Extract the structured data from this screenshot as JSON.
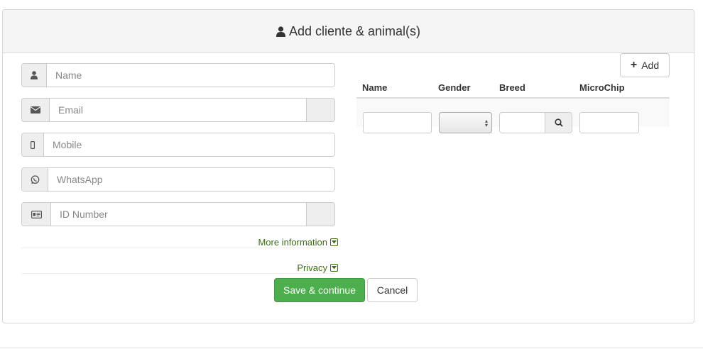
{
  "heading": {
    "title": "Add cliente & animal(s)",
    "icon": "user-icon"
  },
  "client_form": {
    "name": {
      "placeholder": "Name",
      "icon": "user-icon"
    },
    "email": {
      "placeholder": "Email",
      "icon": "envelope-icon"
    },
    "mobile": {
      "placeholder": "Mobile",
      "icon": "mobile-icon"
    },
    "whatsapp": {
      "placeholder": "WhatsApp",
      "icon": "whatsapp-icon"
    },
    "id_number": {
      "placeholder": "ID Number",
      "icon": "id-card-icon"
    }
  },
  "toggles": {
    "more_info": "More information",
    "privacy": "Privacy"
  },
  "animals": {
    "add_label": "Add",
    "columns": [
      "Name",
      "Gender",
      "Breed",
      "MicroChip"
    ]
  },
  "actions": {
    "save_label": "Save & continue",
    "cancel_label": "Cancel"
  },
  "colors": {
    "accent_green": "#4cae4c",
    "link_green": "#3c6e12"
  }
}
